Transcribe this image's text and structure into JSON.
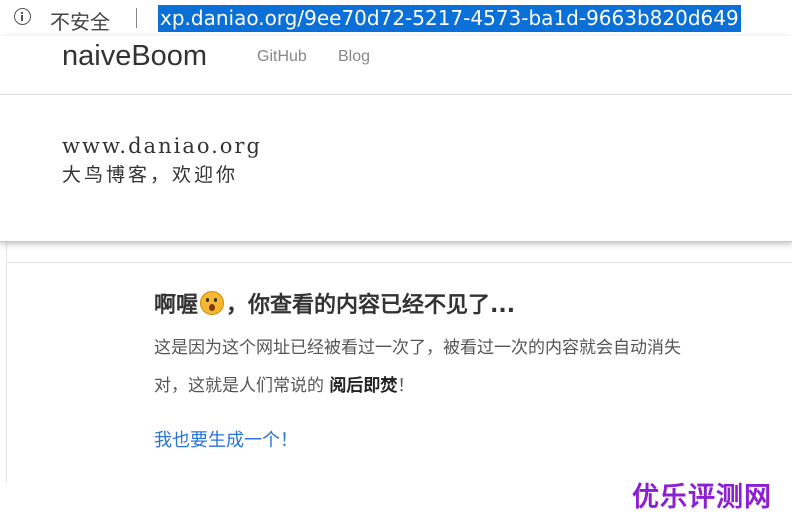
{
  "browser": {
    "security_label": "不安全",
    "url": "xp.daniao.org/9ee70d72-5217-4573-ba1d-9663b820d649"
  },
  "overlay": {
    "brand": "naiveBoom",
    "nav": [
      "GitHub",
      "Blog"
    ],
    "line1": "www.daniao.org",
    "line2": "大鸟博客，欢迎你"
  },
  "page": {
    "brand": "naiveBoom",
    "headline_part1": "啊喔",
    "headline_part2": "，你查看的内容已经不见了...",
    "emoji": "hushed-face",
    "para_line1": "这是因为这个网址已经被看过一次了，被看过一次的内容就会自动消失",
    "para_line2_prefix": "对，这就是人们常说的 ",
    "para_line2_bold": "阅后即焚",
    "para_line2_suffix": "！",
    "link": "我也要生成一个！"
  },
  "watermark": "优乐评测网"
}
